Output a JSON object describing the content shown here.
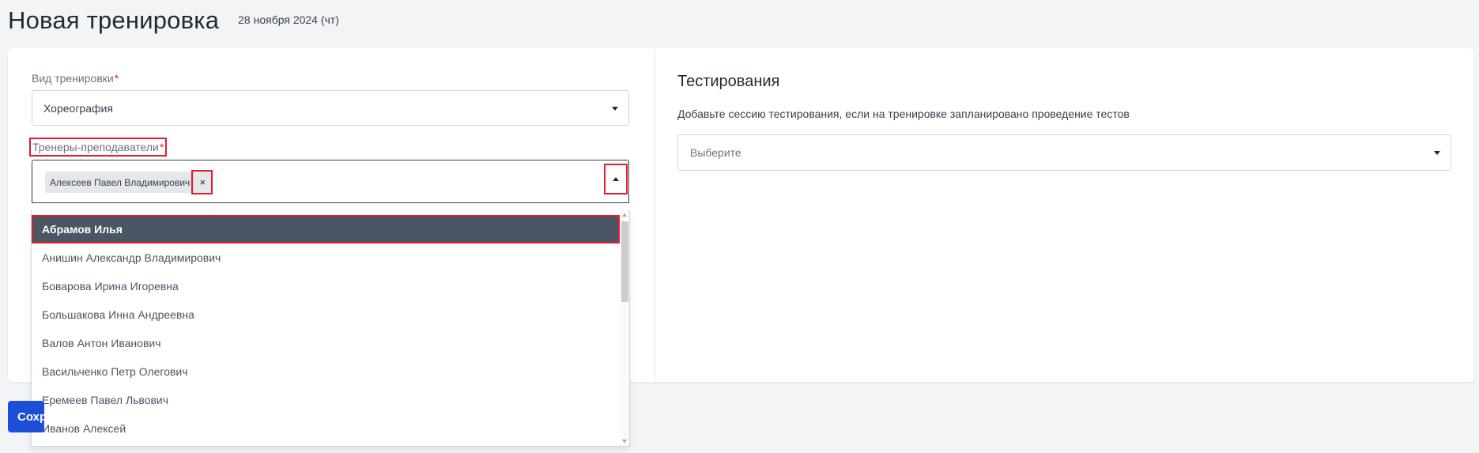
{
  "header": {
    "title": "Новая тренировка",
    "date": "28 ноября 2024 (чт)"
  },
  "training_type": {
    "label": "Вид тренировки",
    "required_mark": "*",
    "value": "Хореография"
  },
  "coaches": {
    "label": "Тренеры-преподаватели",
    "required_mark": "*",
    "selected_tag": "Алексеев Павел Владимирович",
    "tag_remove": "×",
    "options": [
      "Абрамов Илья",
      "Анишин Александр Владимирович",
      "Боварова Ирина Игоревна",
      "Большакова Инна Андреевна",
      "Валов Антон Иванович",
      "Васильченко Петр Олегович",
      "Еремеев Павел Львович",
      "Иванов Алексей"
    ]
  },
  "testing": {
    "title": "Тестирования",
    "description": "Добавьте сессию тестирования, если на тренировке запланировано проведение тестов",
    "placeholder": "Выберите"
  },
  "footer": {
    "submit_label": "Сохранить"
  },
  "colors": {
    "highlight": "#e11d2e",
    "active_option_bg": "#4b5563",
    "primary_button": "#1d4ed8"
  }
}
